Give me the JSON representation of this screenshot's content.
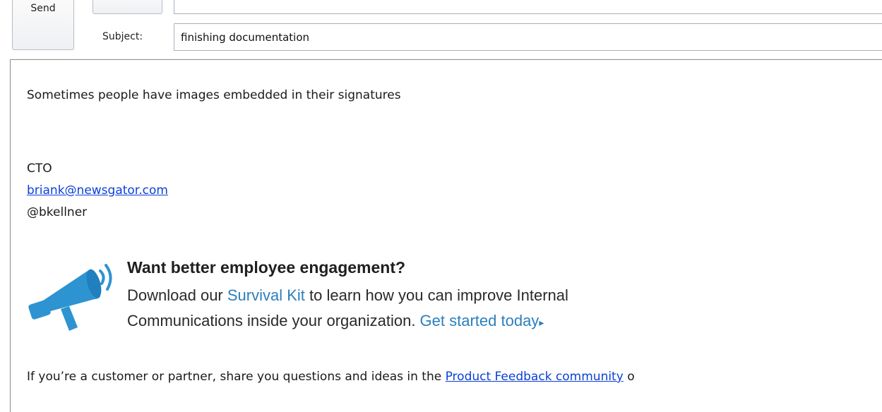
{
  "toolbar": {
    "send_label": "Send"
  },
  "subject": {
    "label": "Subject:",
    "value": "finishing documentation"
  },
  "message": {
    "intro": "Sometimes people have images embedded in their signatures",
    "title": "CTO",
    "email": "briank@newsgator.com",
    "handle": "@bkellner",
    "promo": {
      "heading": "Want better employee engagement?",
      "line1_prefix": "Download our ",
      "line1_link": "Survival Kit",
      "line1_suffix": " to learn how you can improve Internal",
      "line2_prefix": "Communications inside your organization. ",
      "line2_link": "Get started today",
      "arrow": "▸",
      "icon": "megaphone-icon",
      "icon_color": "#2e93d1"
    },
    "footer_prefix": "If you’re a customer or partner, share you questions and ideas in the ",
    "footer_link": "Product Feedback community",
    "footer_suffix": " o"
  },
  "colors": {
    "link": "#0b3fd8",
    "promo_link": "#2c7fbd"
  }
}
